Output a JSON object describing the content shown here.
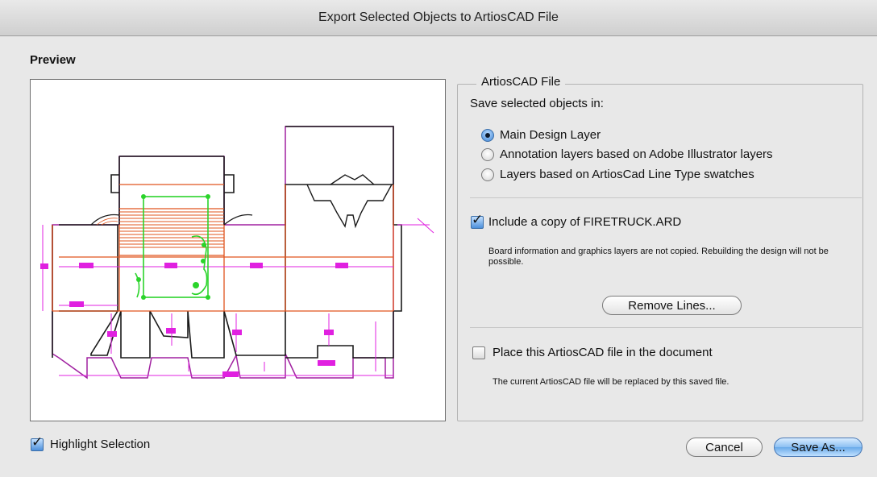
{
  "window": {
    "title": "Export Selected Objects to ArtiosCAD File"
  },
  "preview": {
    "section_title": "Preview",
    "highlight_label": "Highlight Selection",
    "highlight_checked": true
  },
  "artios": {
    "group_label": "ArtiosCAD File",
    "save_label": "Save selected objects in:",
    "options": [
      {
        "label": "Main Design Layer",
        "selected": true
      },
      {
        "label": "Annotation layers based on Adobe Illustrator layers",
        "selected": false
      },
      {
        "label": "Layers based on ArtiosCad Line Type swatches",
        "selected": false
      }
    ],
    "include_copy": {
      "label": "Include a copy of FIRETRUCK.ARD",
      "checked": true,
      "note": "Board information and graphics layers are not copied.  Rebuilding the design will not be possible."
    },
    "remove_lines_label": "Remove Lines...",
    "place_file": {
      "label": "Place this ArtiosCAD file in the document",
      "checked": false,
      "note": "The current ArtiosCAD file will be replaced by this saved file."
    }
  },
  "buttons": {
    "cancel": "Cancel",
    "save_as": "Save As..."
  },
  "colors": {
    "cut_line": "#1a1a1a",
    "crease_line": "#e0541e",
    "dimension_line": "#e020e0",
    "selection": "#2bd42b"
  }
}
